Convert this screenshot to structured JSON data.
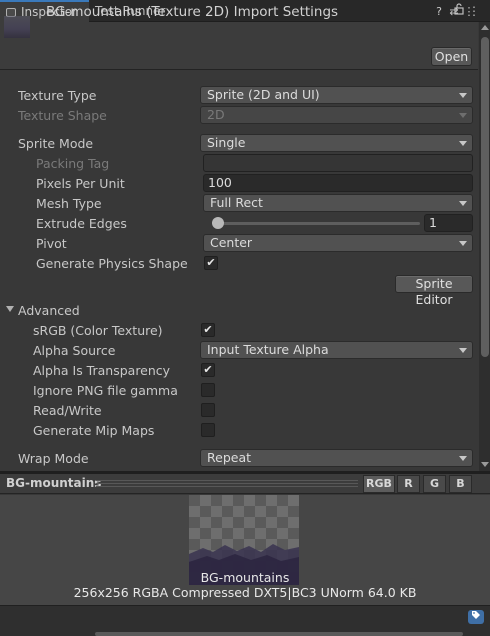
{
  "tabs": [
    {
      "label": "Inspector",
      "active": true
    },
    {
      "label": "Test Runner",
      "active": false
    }
  ],
  "tab_buttons": {
    "lock_icon": "🔒",
    "menu_icon": "⋮"
  },
  "header": {
    "title": "BG-mountains (Texture 2D) Import Settings",
    "help_icon": "?",
    "preset_icon": "⇄",
    "menu_icon": "⋮",
    "open_button": "Open"
  },
  "fields": {
    "texture_type": {
      "label": "Texture Type",
      "value": "Sprite (2D and UI)"
    },
    "texture_shape": {
      "label": "Texture Shape",
      "value": "2D"
    },
    "sprite_mode": {
      "label": "Sprite Mode",
      "value": "Single"
    },
    "packing_tag": {
      "label": "Packing Tag",
      "value": ""
    },
    "pixels_per_unit": {
      "label": "Pixels Per Unit",
      "value": "100"
    },
    "mesh_type": {
      "label": "Mesh Type",
      "value": "Full Rect"
    },
    "extrude_edges": {
      "label": "Extrude Edges",
      "value": "1",
      "slider_fraction": 0.03
    },
    "pivot": {
      "label": "Pivot",
      "value": "Center"
    },
    "generate_physics_shape": {
      "label": "Generate Physics Shape",
      "checked": true
    },
    "sprite_editor_button": "Sprite Editor"
  },
  "advanced": {
    "label": "Advanced",
    "srgb": {
      "label": "sRGB (Color Texture)",
      "checked": true
    },
    "alpha_source": {
      "label": "Alpha Source",
      "value": "Input Texture Alpha"
    },
    "alpha_is_transparency": {
      "label": "Alpha Is Transparency",
      "checked": true
    },
    "ignore_png_gamma": {
      "label": "Ignore PNG file gamma",
      "checked": false
    },
    "read_write": {
      "label": "Read/Write",
      "checked": false
    },
    "generate_mip_maps": {
      "label": "Generate Mip Maps",
      "checked": false
    }
  },
  "wrap_mode": {
    "label": "Wrap Mode",
    "value": "Repeat"
  },
  "preview": {
    "name": "BG-mountains",
    "channels": [
      "RGB",
      "R",
      "G",
      "B"
    ],
    "active_channel": "RGB",
    "title": "BG-mountains",
    "info": "256x256  RGBA Compressed DXT5|BC3 UNorm   64.0 KB"
  },
  "check_glyph": "✔"
}
